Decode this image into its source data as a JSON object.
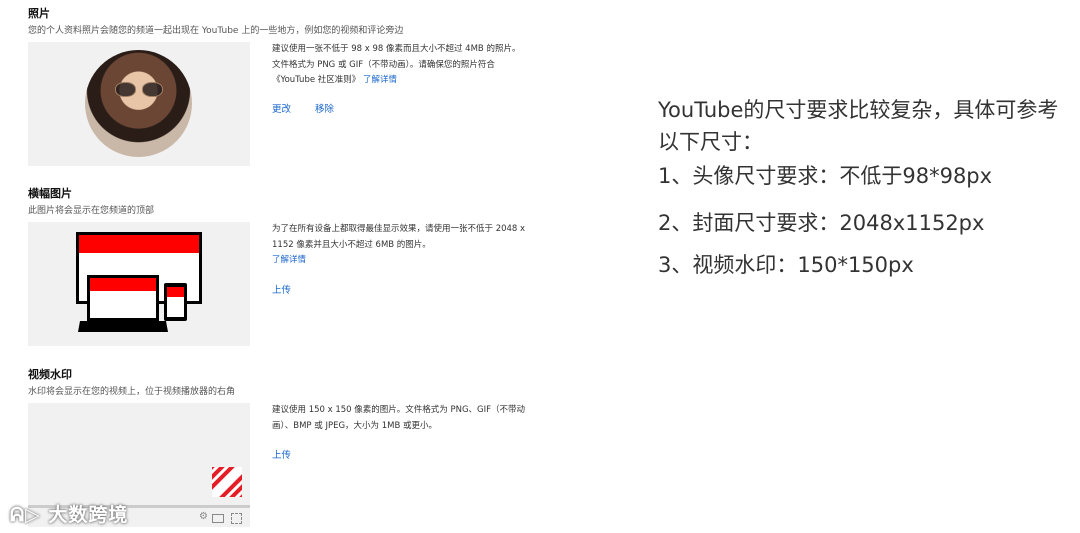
{
  "photo": {
    "title": "照片",
    "subtitle": "您的个人资料照片会随您的频道一起出现在 YouTube 上的一些地方，例如您的视频和评论旁边",
    "desc": "建议使用一张不低于 98 x 98 像素而且大小不超过 4MB 的照片。文件格式为 PNG 或 GIF（不带动画）。请确保您的照片符合《YouTube 社区准则》",
    "learn_more": "了解详情",
    "change": "更改",
    "remove": "移除"
  },
  "banner": {
    "title": "横幅图片",
    "subtitle": "此图片将会显示在您频道的顶部",
    "desc": "为了在所有设备上都取得最佳显示效果，请使用一张不低于 2048 x 1152 像素并且大小不超过 6MB 的图片。",
    "learn_more": "了解详情",
    "upload": "上传"
  },
  "watermark": {
    "title": "视频水印",
    "subtitle": "水印将会显示在您的视频上，位于视频播放器的右角",
    "desc": "建议使用 150 x 150 像素的图片。文件格式为 PNG、GIF（不带动画）、BMP 或 JPEG，大小为 1MB 或更小。",
    "upload": "上传"
  },
  "right": {
    "line1": "YouTube的尺寸要求比较复杂，具体可参考以下尺寸：",
    "line2": "1、头像尺寸要求：不低于98*98px",
    "line3": "2、封面尺寸要求：2048x1152px",
    "line4": "3、视频水印：150*150px"
  },
  "brand_watermark": "大数跨境",
  "colors": {
    "accent_link": "#1a66cc",
    "banner_red": "#ff0000"
  }
}
